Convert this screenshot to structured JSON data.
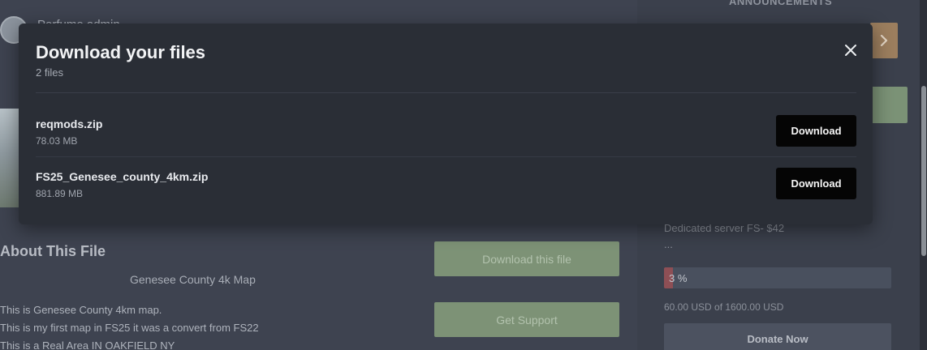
{
  "background": {
    "username": "Perfume admin",
    "about_title": "About This File",
    "map_title": "Genesee County 4k Map",
    "description_lines": [
      "This is Genesee County 4km map.",
      "This is my first map in FS25 it was a convert from FS22",
      "This is a Real Area IN OAKFIELD NY"
    ],
    "download_this_file_label": "Download this file",
    "get_support_label": "Get Support",
    "sidebar": {
      "announcements_label": "ANNOUNCEMENTS",
      "server_text": "Dedicated server FS- $42",
      "ellipsis": "...",
      "progress_text": "3 %",
      "progress_fraction": 0.0375,
      "goal_text": "60.00 USD of 1600.00 USD",
      "donate_label": "Donate Now"
    }
  },
  "modal": {
    "title": "Download your files",
    "subtitle": "2 files",
    "files": [
      {
        "name": "reqmods.zip",
        "size": "78.03 MB",
        "button_label": "Download"
      },
      {
        "name": "FS25_Genesee_county_4km.zip",
        "size": "881.89 MB",
        "button_label": "Download"
      }
    ]
  },
  "colors": {
    "modal_bg": "#2a2e36",
    "download_button_bg": "#050505",
    "green_button_bg": "#7d9276",
    "progress_fill": "#8e4f55"
  },
  "icons": {
    "close": "close-icon",
    "next": "chevron-right-icon"
  }
}
